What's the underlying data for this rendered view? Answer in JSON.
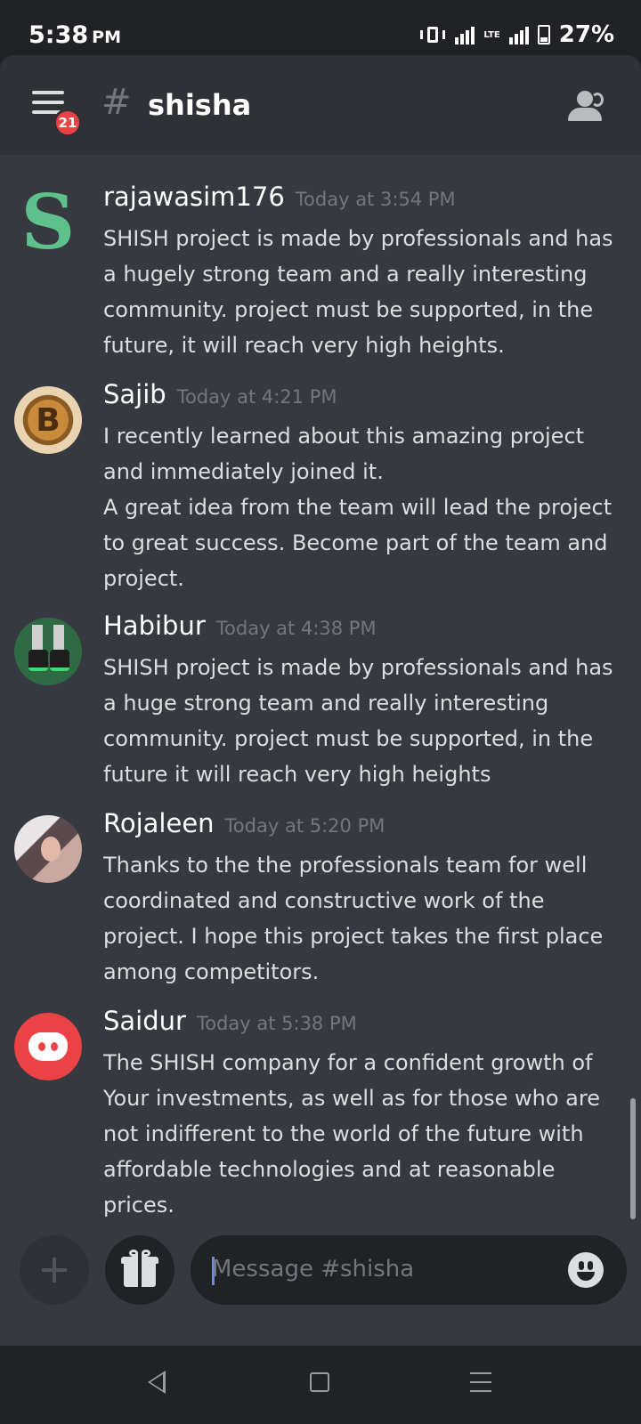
{
  "status_bar": {
    "time": "5:38",
    "ampm": "PM",
    "lte_label": "LTE",
    "battery_percent": "27%"
  },
  "header": {
    "notification_count": "21",
    "channel_hash": "#",
    "channel_name": "shisha"
  },
  "messages": [
    {
      "author": "rajawasim176",
      "timestamp": "Today at 3:54 PM",
      "avatar": "letter-s-avatar",
      "avatar_text": "S",
      "lines": [
        "SHISH project is made by professionals and has a hugely strong team and a really interesting community. project must be supported, in the future, it will reach very high heights."
      ]
    },
    {
      "author": "Sajib",
      "timestamp": "Today at 4:21 PM",
      "avatar": "bitcoin-coin-avatar",
      "avatar_text": "B",
      "lines": [
        "I recently learned about this amazing project and immediately joined it.",
        "A great idea from the team will lead the project to great success. Become part of the team and project."
      ]
    },
    {
      "author": "Habibur",
      "timestamp": "Today at 4:38 PM",
      "avatar": "sneakers-avatar",
      "lines": [
        "SHISH project is made by professionals and has a huge strong team and really interesting community. project must be supported, in the future it will reach very high heights"
      ]
    },
    {
      "author": "Rojaleen",
      "timestamp": "Today at 5:20 PM",
      "avatar": "photo-avatar",
      "lines": [
        "Thanks to the the professionals team for well coordinated and constructive work of  the project. I hope this project takes the first place among competitors."
      ]
    },
    {
      "author": "Saidur",
      "timestamp": "Today at 5:38 PM",
      "avatar": "discord-default-avatar",
      "lines": [
        "The SHISH company for a confident growth of Your investments, as well as for those who are not indifferent to the world of the future with affordable technologies and at reasonable prices."
      ]
    }
  ],
  "composer": {
    "placeholder": "Message #shisha"
  },
  "colors": {
    "background": "#36393f",
    "header": "#2f3136",
    "badge": "#ed4245",
    "timestamp": "#72767d",
    "accent": "#7289da"
  },
  "icons": {
    "menu": "hamburger-menu-icon",
    "members": "members-icon",
    "add": "plus-icon",
    "gift": "gift-icon",
    "emoji": "emoji-icon",
    "nav_back": "back-triangle-icon",
    "nav_home": "home-square-icon",
    "nav_recent": "recent-apps-icon"
  }
}
